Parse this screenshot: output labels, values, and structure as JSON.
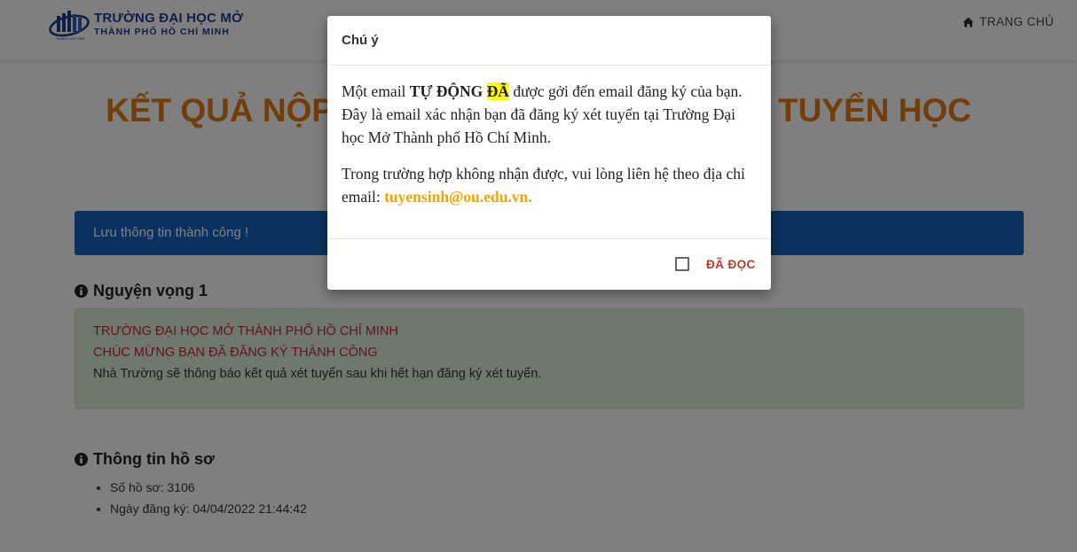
{
  "header": {
    "logo_line1": "TRƯỜNG ĐẠI HỌC MỞ",
    "logo_line2": "THÀNH PHỐ HỒ CHÍ MINH",
    "logo_tagline": "THÀNH LẬP 1990",
    "nav_home": "TRANG CHỦ",
    "brand_color": "#1b3f8f"
  },
  "main": {
    "heading_left": "KẾT QUẢ NỘP",
    "heading_right": "T TUYỂN HỌC",
    "alert": "Lưu thông tin thành công !",
    "section1_title": "Nguyện vọng 1",
    "success_line1": "TRƯỜNG ĐẠI HỌC MỞ THÀNH PHỐ HỒ CHÍ MINH",
    "success_line2": "CHÚC MỪNG BẠN ĐÃ ĐĂNG KÝ THÀNH CÔNG",
    "success_line3": "Nhà Trường sẽ thông báo kết quả xét tuyển sau khi hết hạn đăng ký xét tuyển.",
    "section2_title": "Thông tin hồ sơ",
    "profile_items": [
      "Số hồ sơ: 3106",
      "Ngày đăng ký: 04/04/2022 21:44:42"
    ],
    "heading_color": "#e07b16",
    "alert_color": "#1565c0"
  },
  "modal": {
    "title": "Chú ý",
    "p1_before": "Một email ",
    "p1_bold": "TỰ ĐỘNG",
    "p1_space": " ",
    "p1_highlight": "ĐÃ",
    "p1_after": " được gởi đến email đăng ký của bạn. Đây là email xác nhận bạn đã đăng ký xét tuyển tại Trường Đại học Mở Thành phố Hồ Chí Minh.",
    "p2_before": "Trong trường hợp không nhận được, vui lòng liên hệ theo địa chỉ email: ",
    "p2_email": "tuyensinh@ou.edu.vn.",
    "read_label": "ĐÃ ĐỌC",
    "read_checked": false
  },
  "icons": {
    "home": "home-icon",
    "info": "info-circle-icon",
    "checkbox": "checkbox-icon"
  }
}
